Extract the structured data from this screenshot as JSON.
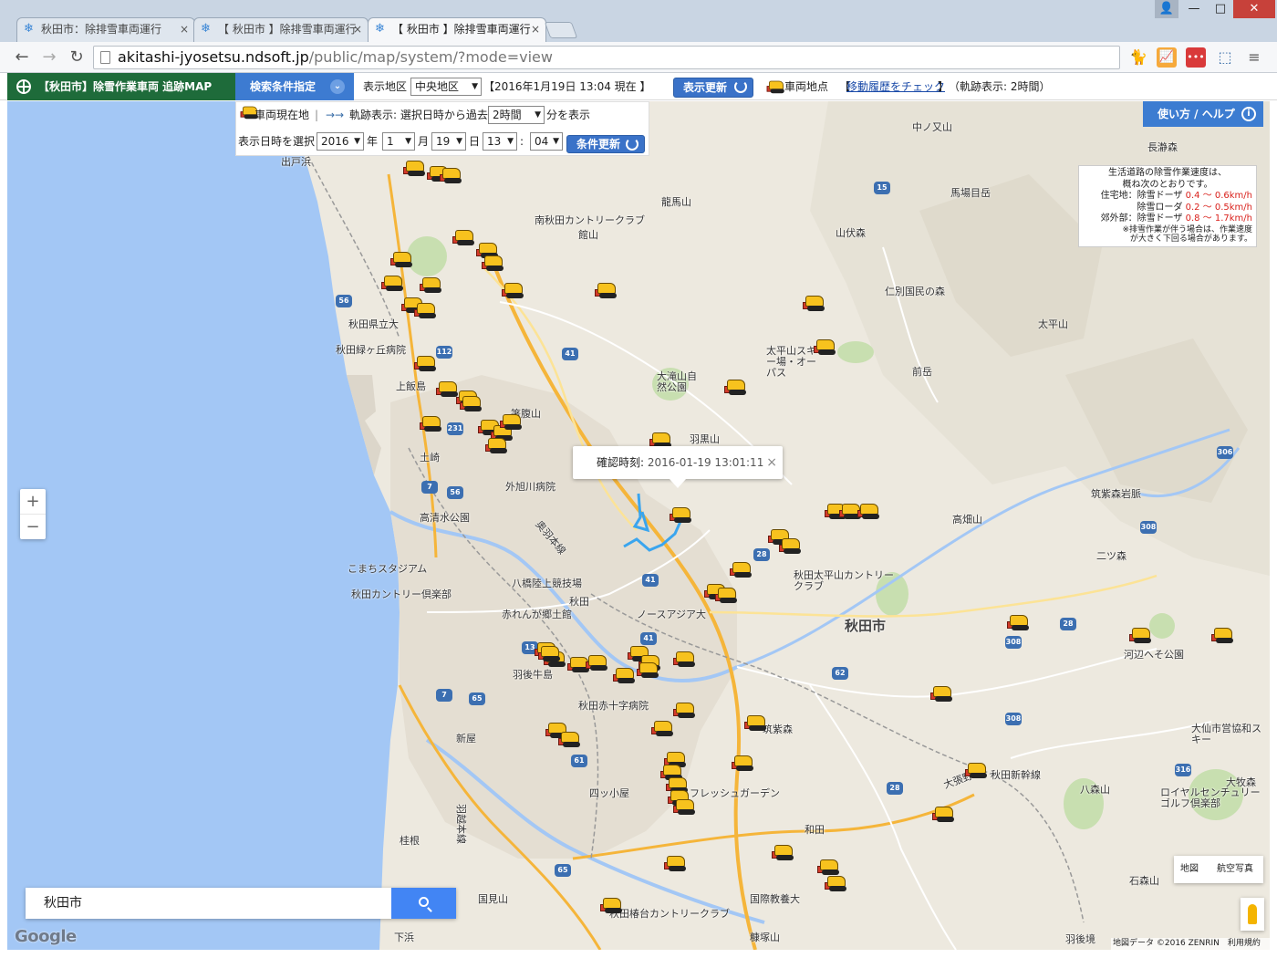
{
  "browser": {
    "tabs": [
      {
        "title": "秋田市：除排雪車両運行",
        "close": "×"
      },
      {
        "title": "【 秋田市 】除排雪車両運行",
        "close": "×"
      },
      {
        "title": "【 秋田市 】除排雪車両運行",
        "close": "×"
      }
    ],
    "window": {
      "user": "👤",
      "min": "—",
      "max": "□",
      "close": "✕"
    },
    "nav": {
      "back": "←",
      "forward": "→",
      "reload": "↻"
    },
    "url_host": "akitashi-jyosetsu.ndsoft.jp",
    "url_path": "/public/map/system/?mode=view",
    "extensions": {
      "cat": "🐈",
      "chart": "📈",
      "red": "•••",
      "cast": "⬚",
      "menu": "≡"
    }
  },
  "header": {
    "brand": "【秋田市】除雪作業車両 追跡MAP",
    "search_toggle": "検索条件指定",
    "search_toggle_icon": "⌄",
    "area_label": "表示地区",
    "area_value": "中央地区",
    "datetime_status": "【2016年1月19日 13:04 現在 】",
    "refresh_button": "表示更新",
    "vehicle_location": "車両地点",
    "history_link": "移動履歴をチェック",
    "history_bracket_open": "【",
    "history_bracket_close": "】",
    "trail_status": "（軌跡表示: 2時間）"
  },
  "conditions": {
    "current_location": "車両現在地",
    "separator": "|",
    "trail_arrow": "→→",
    "trail_label": "軌跡表示: 選択日時から過去",
    "trail_value": "2時間",
    "trail_suffix": "分を表示",
    "datetime_label": "表示日時を選択",
    "year": "2016",
    "year_unit": "年",
    "month": "1",
    "month_unit": "月",
    "day": "19",
    "day_unit": "日",
    "hour": "13",
    "colon": ":",
    "minute": "04",
    "update_button": "条件更新"
  },
  "map": {
    "help_button": "使い方 / ヘルプ",
    "help_icon": "i",
    "speed_legend": {
      "title1": "生活道路の除雪作業速度は、",
      "title2": "概ね次のとおりです。",
      "row1_area": "住宅地：",
      "row1_type": "除雪ドーザ",
      "row1_speed": "0.4 〜 0.6km/h",
      "row2_type": "除雪ローダ",
      "row2_speed": "0.2 〜 0.5km/h",
      "row3_area": "郊外部：",
      "row3_type": "除雪ドーザ",
      "row3_speed": "0.8 〜 1.7km/h",
      "note1": "※排雪作業が伴う場合は、作業速度",
      "note2": "が大きく下回る場合があります。"
    },
    "zoom_in": "+",
    "zoom_out": "−",
    "info_window": {
      "label": "確認時刻:",
      "value": "2016-01-19 13:01:11",
      "close": "×"
    },
    "search_value": "秋田市",
    "map_type_map": "地図",
    "map_type_satellite": "航空写真",
    "google": "Google",
    "attribution": "地図データ ©2016 ZENRIN　利用規約",
    "places": [
      {
        "t": "中ノ又山"
      },
      {
        "t": "長瀞森"
      },
      {
        "t": "馬場目岳"
      },
      {
        "t": "龍馬山"
      },
      {
        "t": "南秋田カントリークラブ"
      },
      {
        "t": "館山"
      },
      {
        "t": "山伏森"
      },
      {
        "t": "仁別国民の森"
      },
      {
        "t": "太平山"
      },
      {
        "t": "太平山スキー場・オーパス"
      },
      {
        "t": "前岳"
      },
      {
        "t": "大滝山自然公園"
      },
      {
        "t": "羽黒山"
      },
      {
        "t": "箸腹山"
      },
      {
        "t": "上飯島"
      },
      {
        "t": "土崎"
      },
      {
        "t": "外旭川病院"
      },
      {
        "t": "高清水公園"
      },
      {
        "t": "秋田県立大"
      },
      {
        "t": "秋田緑ヶ丘病院"
      },
      {
        "t": "出戸浜"
      },
      {
        "t": "奥羽本線"
      },
      {
        "t": "こまちスタジアム"
      },
      {
        "t": "八橋陸上競技場"
      },
      {
        "t": "秋田カントリー倶楽部"
      },
      {
        "t": "秋田"
      },
      {
        "t": "赤れんが郷土館"
      },
      {
        "t": "ノースアジア大"
      },
      {
        "t": "秋田太平山カントリークラブ"
      },
      {
        "t": "秋田市"
      },
      {
        "t": "高畑山"
      },
      {
        "t": "二ツ森"
      },
      {
        "t": "筑紫森岩脈"
      },
      {
        "t": "河辺へそ公園"
      },
      {
        "t": "羽後牛島"
      },
      {
        "t": "秋田赤十字病院"
      },
      {
        "t": "筑紫森"
      },
      {
        "t": "新屋"
      },
      {
        "t": "四ッ小屋"
      },
      {
        "t": "フレッシュガーデン"
      },
      {
        "t": "大張野"
      },
      {
        "t": "秋田新幹線"
      },
      {
        "t": "八森山"
      },
      {
        "t": "大牧森"
      },
      {
        "t": "大仙市営協和スキー"
      },
      {
        "t": "ロイヤルセンチュリーゴルフ倶楽部"
      },
      {
        "t": "和田"
      },
      {
        "t": "桂根"
      },
      {
        "t": "国際教養大"
      },
      {
        "t": "国見山"
      },
      {
        "t": "秋田椿台カントリークラブ"
      },
      {
        "t": "石森山"
      },
      {
        "t": "糠塚山"
      },
      {
        "t": "下浜"
      },
      {
        "t": "羽後境"
      },
      {
        "t": "羽越本線"
      }
    ],
    "shields": [
      "15",
      "56",
      "112",
      "41",
      "231",
      "7",
      "56",
      "28",
      "41",
      "13",
      "41",
      "62",
      "65",
      "61",
      "308",
      "28",
      "308",
      "306",
      "308",
      "316",
      "65",
      "7",
      "28"
    ]
  },
  "colors": {
    "brand_green": "#1e6b3a",
    "accent_blue": "#3d7bd1",
    "sea": "#a3c7f5",
    "land": "#ede9df",
    "urban": "#e4ded2",
    "speed_red": "#d9211c",
    "vehicle_yellow": "#f7c21e",
    "trail_blue": "#3aa5ee"
  }
}
